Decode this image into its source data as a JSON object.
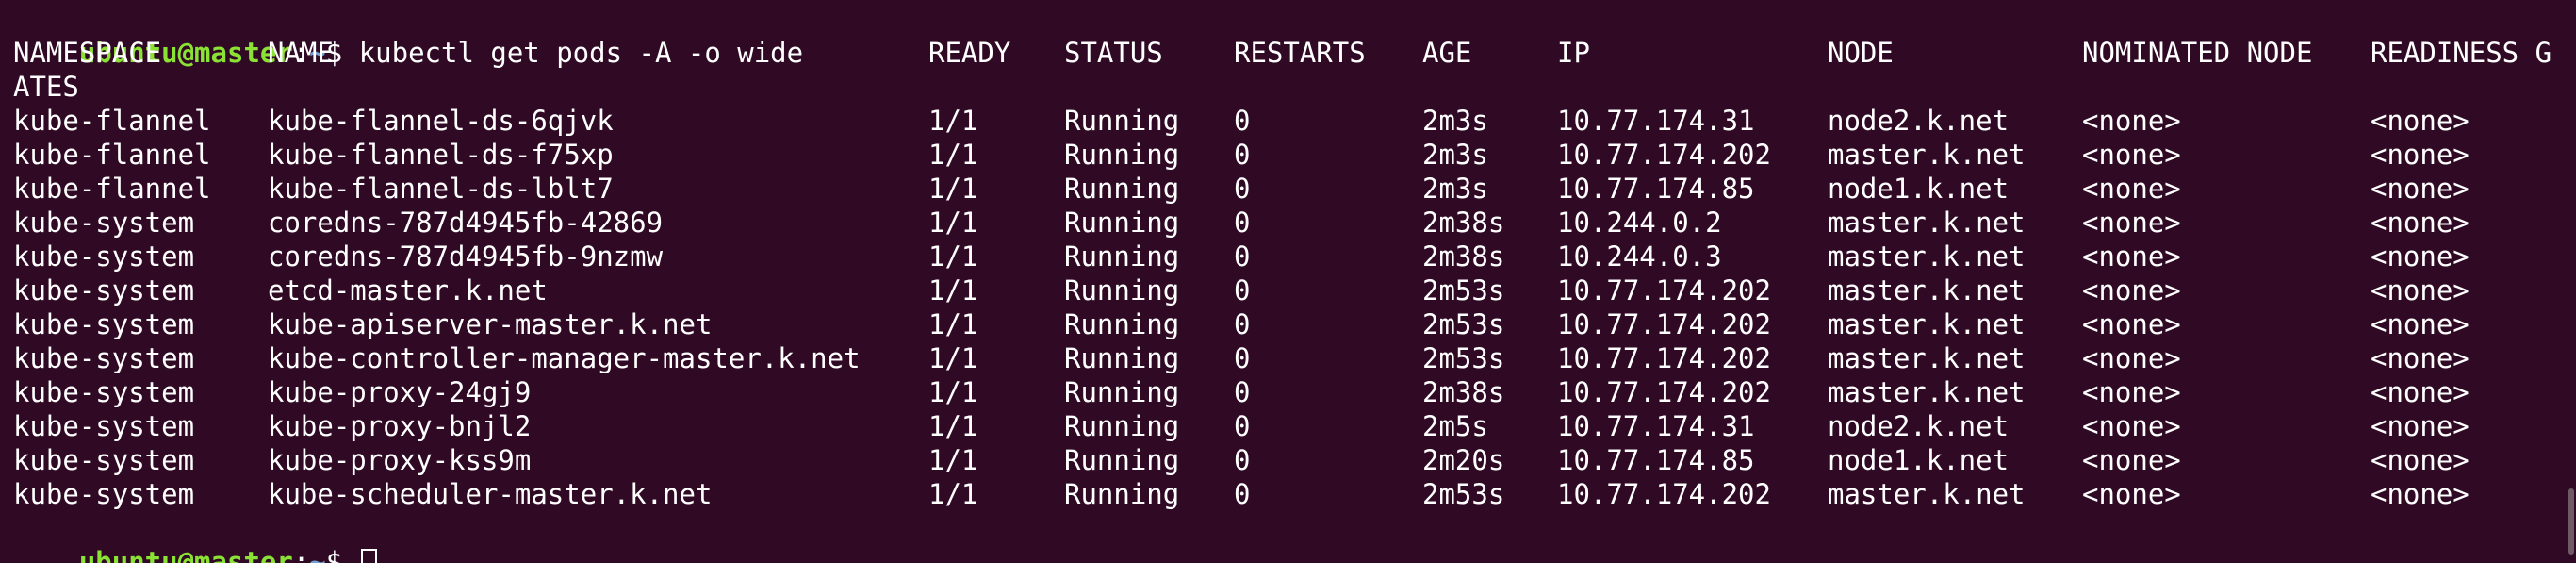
{
  "prompt": {
    "user_host": "ubuntu@master",
    "separator": ":",
    "path": "~",
    "symbol": "$"
  },
  "command": " kubectl get pods -A -o wide",
  "headers": [
    "NAMESPACE",
    "NAME",
    "READY",
    "STATUS",
    "RESTARTS",
    "AGE",
    "IP",
    "NODE",
    "NOMINATED NODE",
    "READINESS G"
  ],
  "header_wrap": "ATES",
  "rows": [
    [
      "kube-flannel",
      "kube-flannel-ds-6qjvk",
      "1/1",
      "Running",
      "0",
      "2m3s",
      "10.77.174.31",
      "node2.k.net",
      "<none>",
      "<none>"
    ],
    [
      "kube-flannel",
      "kube-flannel-ds-f75xp",
      "1/1",
      "Running",
      "0",
      "2m3s",
      "10.77.174.202",
      "master.k.net",
      "<none>",
      "<none>"
    ],
    [
      "kube-flannel",
      "kube-flannel-ds-lblt7",
      "1/1",
      "Running",
      "0",
      "2m3s",
      "10.77.174.85",
      "node1.k.net",
      "<none>",
      "<none>"
    ],
    [
      "kube-system",
      "coredns-787d4945fb-42869",
      "1/1",
      "Running",
      "0",
      "2m38s",
      "10.244.0.2",
      "master.k.net",
      "<none>",
      "<none>"
    ],
    [
      "kube-system",
      "coredns-787d4945fb-9nzmw",
      "1/1",
      "Running",
      "0",
      "2m38s",
      "10.244.0.3",
      "master.k.net",
      "<none>",
      "<none>"
    ],
    [
      "kube-system",
      "etcd-master.k.net",
      "1/1",
      "Running",
      "0",
      "2m53s",
      "10.77.174.202",
      "master.k.net",
      "<none>",
      "<none>"
    ],
    [
      "kube-system",
      "kube-apiserver-master.k.net",
      "1/1",
      "Running",
      "0",
      "2m53s",
      "10.77.174.202",
      "master.k.net",
      "<none>",
      "<none>"
    ],
    [
      "kube-system",
      "kube-controller-manager-master.k.net",
      "1/1",
      "Running",
      "0",
      "2m53s",
      "10.77.174.202",
      "master.k.net",
      "<none>",
      "<none>"
    ],
    [
      "kube-system",
      "kube-proxy-24gj9",
      "1/1",
      "Running",
      "0",
      "2m38s",
      "10.77.174.202",
      "master.k.net",
      "<none>",
      "<none>"
    ],
    [
      "kube-system",
      "kube-proxy-bnjl2",
      "1/1",
      "Running",
      "0",
      "2m5s",
      "10.77.174.31",
      "node2.k.net",
      "<none>",
      "<none>"
    ],
    [
      "kube-system",
      "kube-proxy-kss9m",
      "1/1",
      "Running",
      "0",
      "2m20s",
      "10.77.174.85",
      "node1.k.net",
      "<none>",
      "<none>"
    ],
    [
      "kube-system",
      "kube-scheduler-master.k.net",
      "1/1",
      "Running",
      "0",
      "2m53s",
      "10.77.174.202",
      "master.k.net",
      "<none>",
      "<none>"
    ]
  ],
  "colors": {
    "background": "#300a24",
    "prompt_user": "#8ae234",
    "prompt_path": "#729fcf",
    "text": "#ffffff"
  }
}
